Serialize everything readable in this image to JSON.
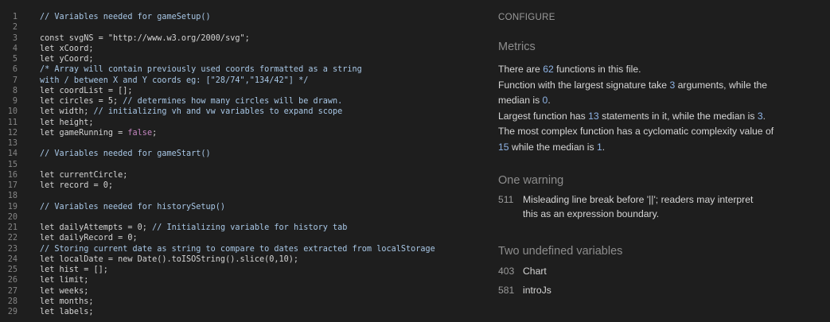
{
  "code": {
    "lines": [
      {
        "n": "1",
        "t": "// Variables needed for gameSetup()",
        "c": "cm"
      },
      {
        "n": "2",
        "t": "",
        "c": ""
      },
      {
        "n": "3",
        "t": "const svgNS = \"http://www.w3.org/2000/svg\";",
        "c": "str"
      },
      {
        "n": "4",
        "t": "let xCoord;",
        "c": "kw"
      },
      {
        "n": "5",
        "t": "let yCoord;",
        "c": "kw"
      },
      {
        "n": "6",
        "t": "/* Array will contain previously used coords formatted as a string",
        "c": "cm"
      },
      {
        "n": "7",
        "t": "with / between X and Y coords eg: [\"28/74\",\"134/42\"] */",
        "c": "cm"
      },
      {
        "n": "8",
        "t": "let coordList = [];",
        "c": "kw"
      },
      {
        "n": "9",
        "t": "let circles = 5; // determines how many circles will be drawn.",
        "c": "mix1"
      },
      {
        "n": "10",
        "t": "let width; // initializing vh and vw variables to expand scope",
        "c": "mix2"
      },
      {
        "n": "11",
        "t": "let height;",
        "c": "kw"
      },
      {
        "n": "12",
        "t": "let gameRunning = false;",
        "c": "bool"
      },
      {
        "n": "13",
        "t": "",
        "c": ""
      },
      {
        "n": "14",
        "t": "// Variables needed for gameStart()",
        "c": "cm"
      },
      {
        "n": "15",
        "t": "",
        "c": ""
      },
      {
        "n": "16",
        "t": "let currentCircle;",
        "c": "kw"
      },
      {
        "n": "17",
        "t": "let record = 0;",
        "c": "kw"
      },
      {
        "n": "18",
        "t": "",
        "c": ""
      },
      {
        "n": "19",
        "t": "// Variables needed for historySetup()",
        "c": "cm"
      },
      {
        "n": "20",
        "t": "",
        "c": ""
      },
      {
        "n": "21",
        "t": "let dailyAttempts = 0; // Initializing variable for history tab",
        "c": "mix3"
      },
      {
        "n": "22",
        "t": "let dailyRecord = 0;",
        "c": "kw"
      },
      {
        "n": "23",
        "t": "// Storing current date as string to compare to dates extracted from localStorage",
        "c": "cm"
      },
      {
        "n": "24",
        "t": "let localDate = new Date().toISOString().slice(0,10);",
        "c": "kw"
      },
      {
        "n": "25",
        "t": "let hist = [];",
        "c": "kw"
      },
      {
        "n": "26",
        "t": "let limit;",
        "c": "kw"
      },
      {
        "n": "27",
        "t": "let weeks;",
        "c": "kw"
      },
      {
        "n": "28",
        "t": "let months;",
        "c": "kw"
      },
      {
        "n": "29",
        "t": "let labels;",
        "c": "kw"
      }
    ]
  },
  "report": {
    "configure": "CONFIGURE",
    "metrics_title": "Metrics",
    "m1_a": "There are ",
    "m1_n": "62",
    "m1_b": " functions in this file.",
    "m2_a": "Function with the largest signature take ",
    "m2_n": "3",
    "m2_b": " arguments, while the median is ",
    "m2_n2": "0",
    "m2_c": ".",
    "m3_a": "Largest function has ",
    "m3_n": "13",
    "m3_b": " statements in it, while the median is ",
    "m3_n2": "3",
    "m3_c": ".",
    "m4_a": "The most complex function has a cyclomatic complexity value of ",
    "m4_n": "15",
    "m4_b": " while the median is ",
    "m4_n2": "1",
    "m4_c": ".",
    "warning_title": "One warning",
    "warning": {
      "line": "511",
      "text": "Misleading line break before '||'; readers may interpret this as an expression boundary."
    },
    "undefined_title": "Two undefined variables",
    "undefined": [
      {
        "line": "403",
        "name": "Chart"
      },
      {
        "line": "581",
        "name": "introJs"
      }
    ]
  }
}
